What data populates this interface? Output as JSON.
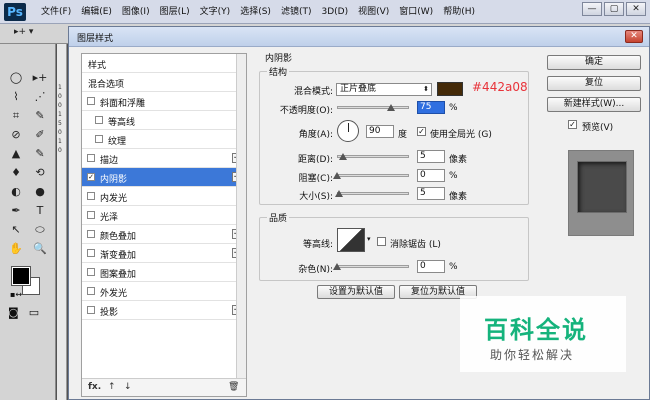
{
  "app": {
    "logo": "Ps",
    "menu": [
      "文件(F)",
      "编辑(E)",
      "图像(I)",
      "图层(L)",
      "文字(Y)",
      "选择(S)",
      "滤镜(T)",
      "3D(D)",
      "视图(V)",
      "窗口(W)",
      "帮助(H)"
    ],
    "window_controls": [
      "—",
      "▢",
      "✕"
    ],
    "options_bar": {
      "tool_glyph": "▸+ ▾"
    }
  },
  "toolbar": {
    "tools": [
      "◯",
      "▸+",
      "⌇",
      "⋰",
      "⌗",
      "✎",
      "⊘",
      "✐",
      "▲",
      "✎",
      "♦",
      "⟲",
      "◐",
      "●",
      "✒",
      "T",
      "↖",
      "⬭",
      "✋",
      "🔍"
    ],
    "mini_swatch": "▪↔"
  },
  "ruler": [
    "1",
    "0",
    "0",
    "1",
    "5",
    "0",
    "1",
    "0"
  ],
  "dialog": {
    "title": "图层样式",
    "close": "✕",
    "style_list": {
      "items": [
        {
          "label": "样式",
          "type": "header"
        },
        {
          "label": "混合选项",
          "type": "header"
        },
        {
          "label": "斜面和浮雕",
          "checked": false,
          "plus": false,
          "indent": 0
        },
        {
          "label": "等高线",
          "checked": false,
          "plus": false,
          "indent": 1
        },
        {
          "label": "纹理",
          "checked": false,
          "plus": false,
          "indent": 1
        },
        {
          "label": "描边",
          "checked": false,
          "plus": true,
          "indent": 0
        },
        {
          "label": "内阴影",
          "checked": true,
          "plus": true,
          "indent": 0,
          "selected": true
        },
        {
          "label": "内发光",
          "checked": false,
          "plus": false,
          "indent": 0
        },
        {
          "label": "光泽",
          "checked": false,
          "plus": false,
          "indent": 0
        },
        {
          "label": "颜色叠加",
          "checked": false,
          "plus": true,
          "indent": 0
        },
        {
          "label": "渐变叠加",
          "checked": false,
          "plus": true,
          "indent": 0
        },
        {
          "label": "图案叠加",
          "checked": false,
          "plus": false,
          "indent": 0
        },
        {
          "label": "外发光",
          "checked": false,
          "plus": false,
          "indent": 0
        },
        {
          "label": "投影",
          "checked": false,
          "plus": true,
          "indent": 0
        }
      ],
      "bottom_icons": [
        "fx.",
        "↑",
        "↓",
        "🗑"
      ]
    },
    "inner_shadow": {
      "section_title": "内阴影",
      "structure_title": "结构",
      "blend_mode_label": "混合模式:",
      "blend_mode_value": "正片叠底",
      "shadow_color": "#442a08",
      "color_annotation": "#442a08",
      "opacity_label": "不透明度(O):",
      "opacity_value": "75",
      "opacity_percent": 75,
      "percent_unit": "%",
      "angle_label": "角度(A):",
      "angle_value": "90",
      "angle_unit": "度",
      "global_light_label": "使用全局光 (G)",
      "global_light_checked": true,
      "distance_label": "距离(D):",
      "distance_value": "5",
      "distance_unit": "像素",
      "choke_label": "阻塞(C):",
      "choke_value": "0",
      "size_label": "大小(S):",
      "size_value": "5",
      "size_unit": "像素",
      "quality_title": "品质",
      "contour_label": "等高线:",
      "antialias_label": "消除锯齿 (L)",
      "antialias_checked": false,
      "noise_label": "杂色(N):",
      "noise_value": "0",
      "set_default_button": "设置为默认值",
      "reset_default_button": "复位为默认值"
    },
    "buttons": {
      "ok": "确定",
      "reset": "复位",
      "new_style": "新建样式(W)...",
      "preview_label": "预览(V)",
      "preview_checked": true
    }
  },
  "watermark": {
    "title": "百科全说",
    "subtitle": "助你轻松解决"
  }
}
